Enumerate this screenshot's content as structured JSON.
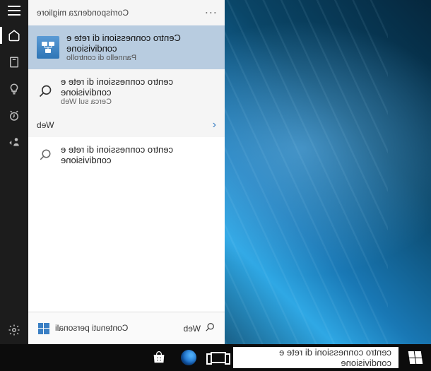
{
  "header": {
    "section_label": "Corrispondenza migliore",
    "menu_dots": "···"
  },
  "best_match": {
    "title": "Centro connessioni di rete e condivisione",
    "subtitle": "Pannello di controllo",
    "icon_name": "network-sharing-icon"
  },
  "web_result": {
    "title": "centro connessioni di rete e condivisione",
    "subtitle": "Cerca sul Web",
    "icon_name": "search-icon"
  },
  "web_section": {
    "label": "Web",
    "chevron": "‹"
  },
  "web_suggestion": {
    "text": "centro connessioni di rete e condivisione",
    "icon_name": "search-icon"
  },
  "bottom_tabs": {
    "web_label": "Web",
    "personal_label": "Contenuti personali"
  },
  "search_box": {
    "value": "centro connessioni di rete e condivisione"
  },
  "sidebar": {
    "items": [
      {
        "name": "hamburger-menu-icon"
      },
      {
        "name": "home-icon"
      },
      {
        "name": "notebook-icon"
      },
      {
        "name": "lightbulb-icon"
      },
      {
        "name": "reminder-icon"
      },
      {
        "name": "feedback-icon"
      }
    ],
    "bottom": {
      "name": "settings-icon"
    }
  },
  "taskbar": {
    "items": [
      {
        "name": "start-button"
      },
      {
        "name": "search-input"
      },
      {
        "name": "task-view-icon"
      },
      {
        "name": "edge-browser-icon"
      },
      {
        "name": "store-icon"
      }
    ]
  }
}
